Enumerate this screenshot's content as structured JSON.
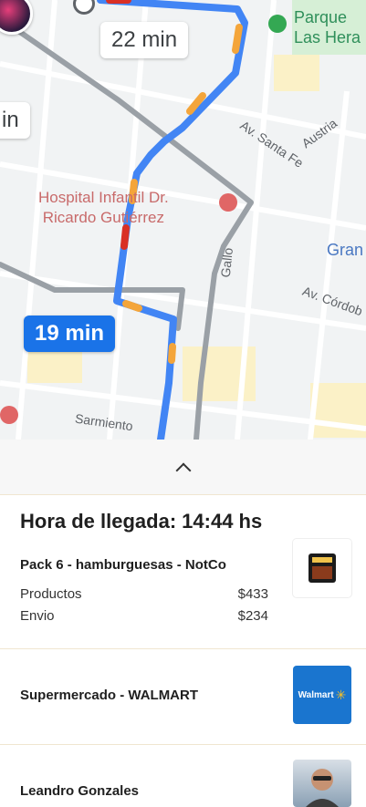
{
  "map": {
    "eta_primary": "19 min",
    "eta_alternate": "22 min",
    "eta_partial": "in",
    "hospital_label": "Hospital Infantil Dr.\nRicardo Gutiérrez",
    "hospital_icon": "H",
    "park_label": "Parque\nLas Hera",
    "streets": {
      "santa_fe": "Av. Santa Fe",
      "austria": "Austria",
      "gallo": "Gallo",
      "cordoba": "Av. Córdob",
      "sarmiento": "Sarmiento",
      "gran": "Gran"
    },
    "colors": {
      "route_blue": "#4285f4",
      "traffic_orange": "#f4a53a",
      "traffic_red": "#d93025",
      "alt_route_gray": "#9aa0a6"
    }
  },
  "sheet": {
    "handle_icon": "chevron-up-icon",
    "arrival_label": "Hora de llegada:",
    "arrival_time": "14:44 hs"
  },
  "orders": [
    {
      "title": "Pack 6 - hamburguesas - NotCo",
      "rows": [
        {
          "label": "Productos",
          "value": "$433"
        },
        {
          "label": "Envio",
          "value": "$234"
        }
      ],
      "thumb_text": "NOT BURGER"
    },
    {
      "title": "Supermercado - WALMART",
      "thumb_text": "Walmart"
    },
    {
      "title": "Leandro Gonzales"
    }
  ]
}
